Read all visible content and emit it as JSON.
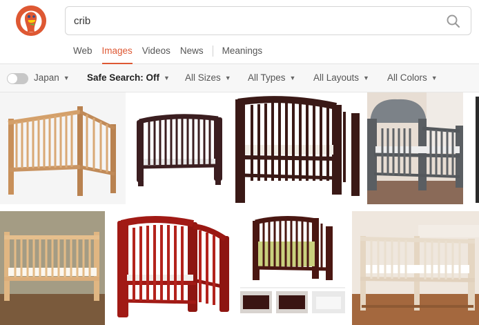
{
  "search": {
    "query": "crib"
  },
  "nav": {
    "tabs": [
      {
        "label": "Web"
      },
      {
        "label": "Images"
      },
      {
        "label": "Videos"
      },
      {
        "label": "News"
      }
    ],
    "meanings_label": "Meanings"
  },
  "filters": {
    "region": "Japan",
    "safe_search": "Safe Search: Off",
    "sizes": "All Sizes",
    "types": "All Types",
    "layouts": "All Layouts",
    "colors": "All Colors"
  },
  "colors": {
    "accent": "#de5833",
    "natural_wood": "#d4a06a",
    "dark_espresso": "#3a1c18",
    "gray_tufted": "#6a6e72",
    "cherry": "#9e1a14",
    "white_wood": "#e8dccb"
  },
  "results": [
    {
      "name": "natural-wood-crib",
      "color": "#c99462"
    },
    {
      "name": "dark-convertible-crib",
      "color": "#3b1e20"
    },
    {
      "name": "espresso-crib",
      "color": "#3a1916"
    },
    {
      "name": "gray-tufted-crib",
      "color": "#6a6e72"
    },
    {
      "name": "light-wood-crib",
      "color": "#e0b682"
    },
    {
      "name": "cherry-crib",
      "color": "#a11a15"
    },
    {
      "name": "cherry-crib-collage",
      "color": "#4a1712"
    },
    {
      "name": "modern-white-crib",
      "color": "#e8e0d4"
    }
  ]
}
